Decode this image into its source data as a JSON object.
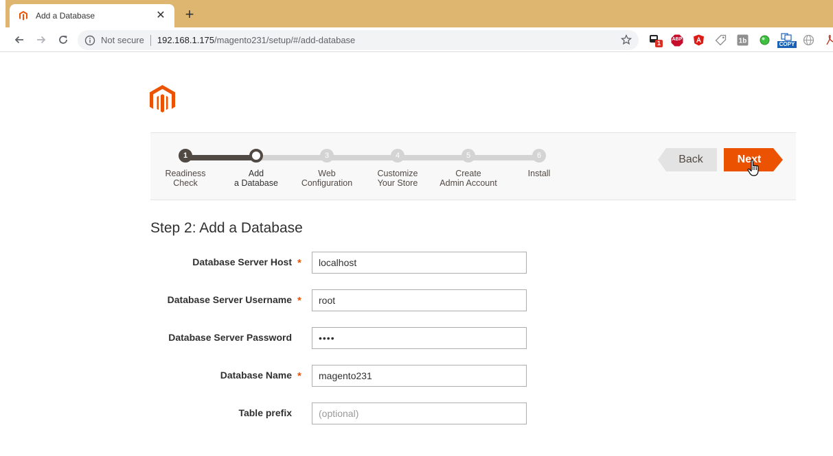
{
  "browser": {
    "tab_title": "Add a Database",
    "security_label": "Not secure",
    "url_host": "192.168.1.175",
    "url_path": "/magento231/setup/#/add-database",
    "extension_badge": "1",
    "extension_abp": "ABP",
    "extension_copy": "COPY"
  },
  "wizard": {
    "steps": [
      {
        "number": "1",
        "line1": "Readiness",
        "line2": "Check"
      },
      {
        "number": "2",
        "line1": "Add",
        "line2": "a Database"
      },
      {
        "number": "3",
        "line1": "Web",
        "line2": "Configuration"
      },
      {
        "number": "4",
        "line1": "Customize",
        "line2": "Your Store"
      },
      {
        "number": "5",
        "line1": "Create",
        "line2": "Admin Account"
      },
      {
        "number": "6",
        "line1": "Install",
        "line2": ""
      }
    ],
    "current_step": 2,
    "back_label": "Back",
    "next_label": "Next"
  },
  "form": {
    "title": "Step 2: Add a Database",
    "required_marker": "*",
    "fields": [
      {
        "label": "Database Server Host",
        "value": "localhost",
        "placeholder": "",
        "required": true
      },
      {
        "label": "Database Server Username",
        "value": "root",
        "placeholder": "",
        "required": true
      },
      {
        "label": "Database Server Password",
        "value": "••••",
        "placeholder": "",
        "required": false
      },
      {
        "label": "Database Name",
        "value": "magento231",
        "placeholder": "",
        "required": true
      },
      {
        "label": "Table prefix",
        "value": "",
        "placeholder": "(optional)",
        "required": false
      }
    ]
  },
  "colors": {
    "accent": "#eb5202",
    "progress_dark": "#514943",
    "progress_gray": "#d4d4d4",
    "tabstrip": "#dfb66f"
  }
}
